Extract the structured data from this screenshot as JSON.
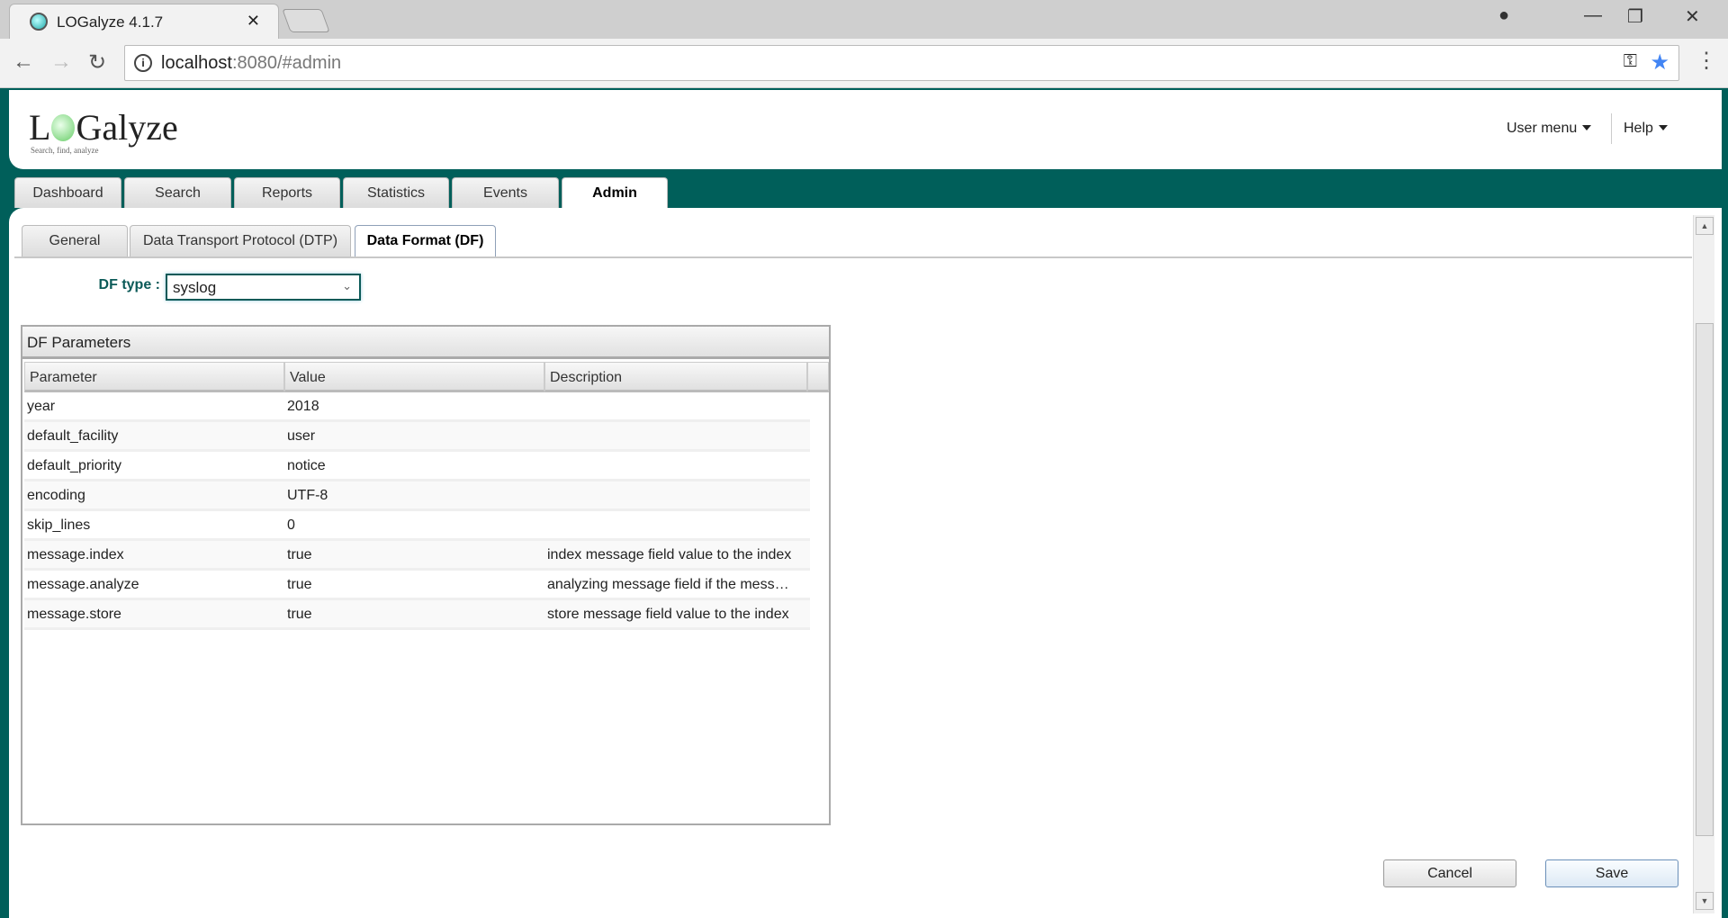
{
  "browser": {
    "tab_title": "LOGalyze 4.1.7",
    "url_host": "localhost",
    "url_path": ":8080/#admin"
  },
  "header": {
    "logo_text_1": "L",
    "logo_text_2": "Galyze",
    "tagline": "Search, find, analyze",
    "user_menu": "User menu",
    "help": "Help"
  },
  "main_tabs": [
    {
      "label": "Dashboard"
    },
    {
      "label": "Search"
    },
    {
      "label": "Reports"
    },
    {
      "label": "Statistics"
    },
    {
      "label": "Events"
    },
    {
      "label": "Admin"
    }
  ],
  "sub_tabs": [
    {
      "label": "General"
    },
    {
      "label": "Data Transport Protocol (DTP)"
    },
    {
      "label": "Data Format (DF)"
    }
  ],
  "df_type": {
    "label": "DF type :",
    "value": "syslog"
  },
  "panel": {
    "title": "DF Parameters",
    "columns": [
      "Parameter",
      "Value",
      "Description"
    ],
    "rows": [
      {
        "p": "year",
        "v": "2018",
        "d": ""
      },
      {
        "p": "default_facility",
        "v": "user",
        "d": ""
      },
      {
        "p": "default_priority",
        "v": "notice",
        "d": ""
      },
      {
        "p": "encoding",
        "v": "UTF-8",
        "d": ""
      },
      {
        "p": "skip_lines",
        "v": "0",
        "d": ""
      },
      {
        "p": "message.index",
        "v": "true",
        "d": "index message field value to the index"
      },
      {
        "p": "message.analyze",
        "v": "true",
        "d": "analyzing message field if the mess…"
      },
      {
        "p": "message.store",
        "v": "true",
        "d": "store message field value to the index"
      }
    ]
  },
  "buttons": {
    "cancel": "Cancel",
    "save": "Save"
  }
}
